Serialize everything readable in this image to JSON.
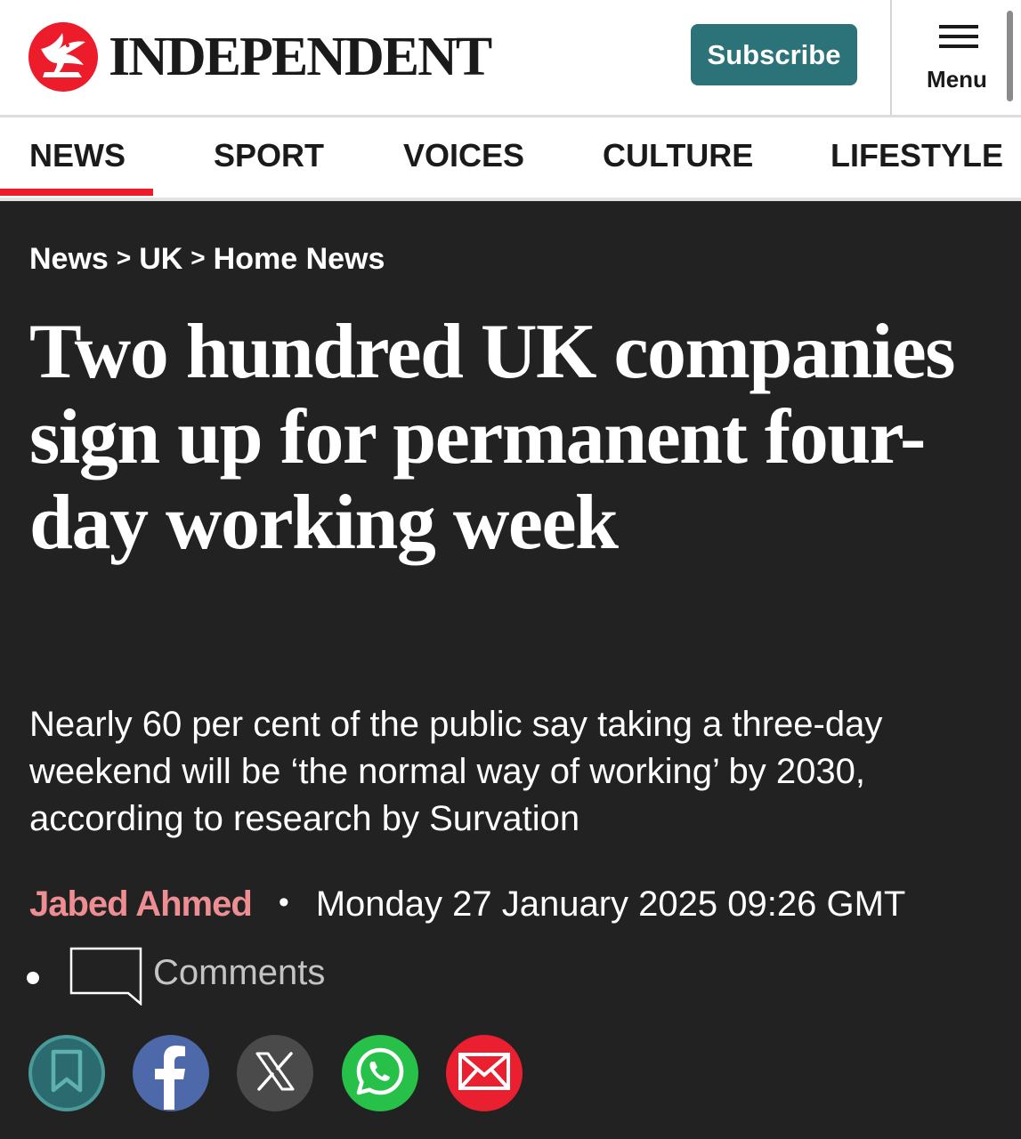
{
  "header": {
    "brand": "INDEPENDENT",
    "subscribe_label": "Subscribe",
    "menu_label": "Menu"
  },
  "nav": {
    "items": [
      {
        "label": "NEWS",
        "active": true
      },
      {
        "label": "SPORT",
        "active": false
      },
      {
        "label": "VOICES",
        "active": false
      },
      {
        "label": "CULTURE",
        "active": false
      },
      {
        "label": "LIFESTYLE",
        "active": false
      }
    ]
  },
  "breadcrumb": {
    "items": [
      "News",
      "UK",
      "Home News"
    ],
    "separator": ">"
  },
  "article": {
    "headline": "Two hundred UK companies sign up for permanent four-day working week",
    "standfirst": "Nearly 60 per cent of the public say taking a three-day weekend will be ‘the normal way of working’ by 2030, according to research by Survation",
    "author": "Jabed Ahmed",
    "byline_separator": "•",
    "date": "Monday 27 January 2025 09:26 GMT",
    "comments_label": "Comments"
  },
  "share": {
    "icons": [
      "bookmark-icon",
      "facebook-icon",
      "x-icon",
      "whatsapp-icon",
      "email-icon"
    ]
  },
  "colors": {
    "brand_red": "#ec1c2a",
    "subscribe_teal": "#2b7379",
    "page_dark": "#222222",
    "author_pink": "#ee8e92",
    "facebook": "#4e69a9",
    "x": "#4a4a4a",
    "whatsapp": "#27c14a",
    "email": "#ea1f2f"
  }
}
